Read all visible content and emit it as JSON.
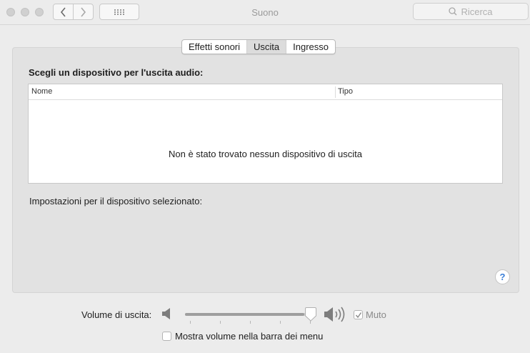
{
  "window": {
    "title": "Suono",
    "search_placeholder": "Ricerca",
    "traffic_light_color": "#d0d0d0"
  },
  "tabs": [
    {
      "label": "Effetti sonori",
      "active": false
    },
    {
      "label": "Uscita",
      "active": true
    },
    {
      "label": "Ingresso",
      "active": false
    }
  ],
  "output": {
    "section_label": "Scegli un dispositivo per l'uscita audio:",
    "columns": [
      "Nome",
      "Tipo"
    ],
    "empty_message": "Non è stato trovato nessun dispositivo di uscita",
    "settings_label": "Impostazioni per il dispositivo selezionato:"
  },
  "help": {
    "label": "?"
  },
  "volume": {
    "label": "Volume di uscita:",
    "level": 0.95,
    "mute_label": "Muto",
    "muted": true,
    "show_in_menu_label": "Mostra volume nella barra dei menu",
    "show_in_menu": false
  },
  "icons": [
    "back-chevron-icon",
    "forward-chevron-icon",
    "grid-icon",
    "search-icon",
    "speaker-low-icon",
    "speaker-high-icon",
    "checkmark-icon"
  ],
  "colors": {
    "help_accent": "#3b7fd8",
    "active_tab": "#dcdcdc"
  }
}
